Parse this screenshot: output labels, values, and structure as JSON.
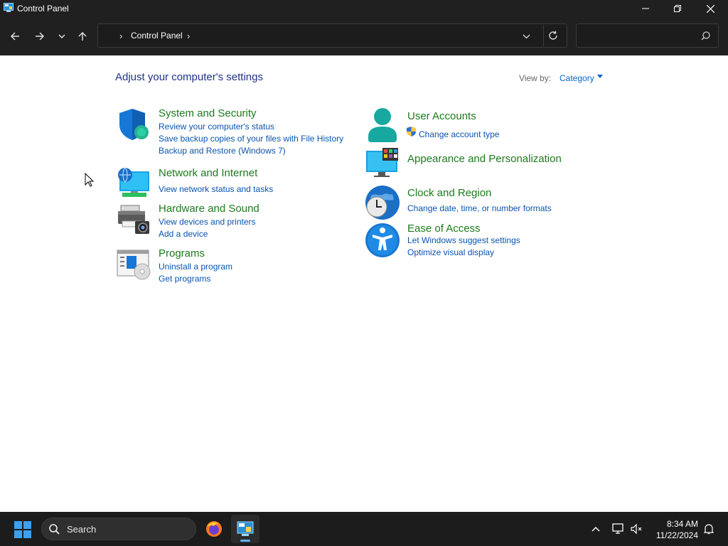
{
  "window": {
    "title": "Control Panel"
  },
  "navbar": {
    "breadcrumb": "Control Panel",
    "search_placeholder": ""
  },
  "content": {
    "heading": "Adjust your computer's settings",
    "view_by_label": "View by:",
    "view_by_value": "Category"
  },
  "categories": {
    "system": {
      "title": "System and Security",
      "links": [
        "Review your computer's status",
        "Save backup copies of your files with File History",
        "Backup and Restore (Windows 7)"
      ]
    },
    "network": {
      "title": "Network and Internet",
      "links": [
        "View network status and tasks"
      ]
    },
    "hardware": {
      "title": "Hardware and Sound",
      "links": [
        "View devices and printers",
        "Add a device"
      ]
    },
    "programs": {
      "title": "Programs",
      "links": [
        "Uninstall a program",
        "Get programs"
      ]
    },
    "users": {
      "title": "User Accounts",
      "links": [
        "Change account type"
      ]
    },
    "appearance": {
      "title": "Appearance and Personalization",
      "links": []
    },
    "clock": {
      "title": "Clock and Region",
      "links": [
        "Change date, time, or number formats"
      ]
    },
    "ease": {
      "title": "Ease of Access",
      "links": [
        "Let Windows suggest settings",
        "Optimize visual display"
      ]
    }
  },
  "taskbar": {
    "search_label": "Search",
    "time": "8:34 AM",
    "date": "11/22/2024"
  }
}
